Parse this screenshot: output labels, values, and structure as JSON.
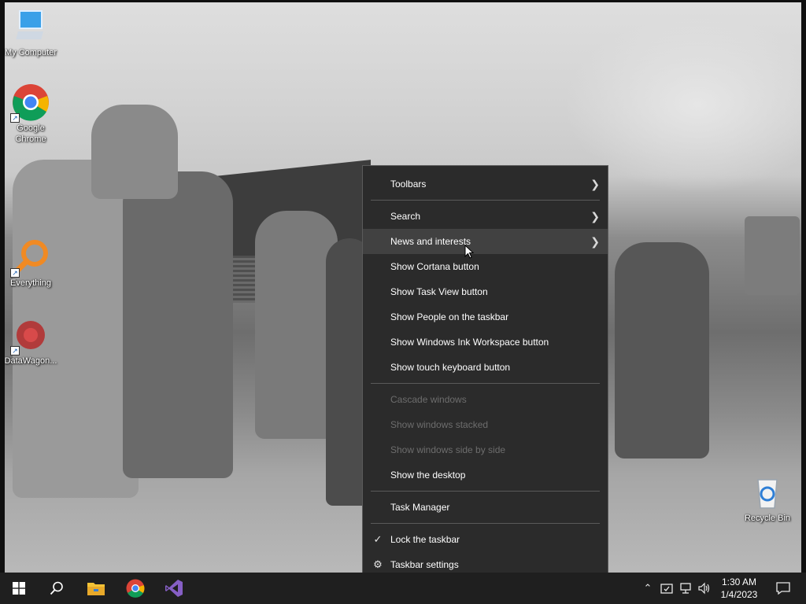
{
  "desktop": {
    "icons": [
      {
        "label": "My Computer",
        "icon": "computer-icon"
      },
      {
        "label": "Google Chrome",
        "icon": "chrome-icon"
      },
      {
        "label": "Everything",
        "icon": "everything-search-icon"
      },
      {
        "label": "DataWagon...",
        "icon": "datawagon-icon"
      },
      {
        "label": "Recycle Bin",
        "icon": "recycle-bin-icon"
      }
    ]
  },
  "context_menu": {
    "items": [
      {
        "label": "Toolbars",
        "submenu": true,
        "enabled": true
      },
      {
        "label": "Search",
        "submenu": true,
        "enabled": true
      },
      {
        "label": "News and interests",
        "submenu": true,
        "enabled": true,
        "hover": true
      },
      {
        "label": "Show Cortana button",
        "enabled": true
      },
      {
        "label": "Show Task View button",
        "enabled": true
      },
      {
        "label": "Show People on the taskbar",
        "enabled": true
      },
      {
        "label": "Show Windows Ink Workspace button",
        "enabled": true
      },
      {
        "label": "Show touch keyboard button",
        "enabled": true
      },
      {
        "label": "Cascade windows",
        "enabled": false
      },
      {
        "label": "Show windows stacked",
        "enabled": false
      },
      {
        "label": "Show windows side by side",
        "enabled": false
      },
      {
        "label": "Show the desktop",
        "enabled": true
      },
      {
        "label": "Task Manager",
        "enabled": true
      },
      {
        "label": "Lock the taskbar",
        "enabled": true,
        "checked": true
      },
      {
        "label": "Taskbar settings",
        "enabled": true,
        "icon": "gear-icon"
      }
    ]
  },
  "taskbar": {
    "start_icon": "windows-start-icon",
    "search_icon": "search-icon",
    "pinned": [
      "file-explorer-icon",
      "chrome-icon",
      "visual-studio-icon"
    ],
    "tray_icons": [
      "chevron-up-icon",
      "security-icon",
      "network-icon",
      "volume-icon"
    ],
    "clock": {
      "time": "1:30 AM",
      "date": "1/4/2023"
    },
    "notification_icon": "action-center-icon"
  },
  "colors": {
    "menu_bg": "#2b2b2b",
    "menu_hover": "#414141",
    "taskbar_bg": "#1f1f1f",
    "vs_purple": "#865fc5",
    "folder_yellow": "#f3c236"
  }
}
